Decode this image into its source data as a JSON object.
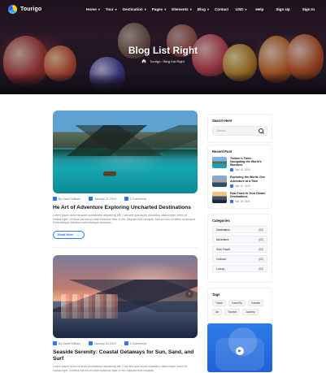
{
  "brand": {
    "name": "Tourigo",
    "colors": {
      "accent": "#2b74ff",
      "muted_text": "#7a7a7a",
      "hero_overlay": "#2f1a2c"
    }
  },
  "nav": {
    "items": [
      {
        "label": "Home"
      },
      {
        "label": "Tour"
      },
      {
        "label": "Destination"
      },
      {
        "label": "Pages"
      },
      {
        "label": "Elements"
      },
      {
        "label": "Blog"
      },
      {
        "label": "Contact"
      }
    ],
    "right": {
      "currency": "USD",
      "help": "Help",
      "signup": "Sign Up",
      "signin": "Sign In"
    }
  },
  "hero": {
    "title": "Blog List Right",
    "breadcrumb": {
      "home": "Tourigo",
      "current": "Blog List Right"
    }
  },
  "posts": [
    {
      "author": "By David William",
      "date": "January 22 2024",
      "comments": "0 Comments",
      "title": "He Art of Adventure Exploring Uncharted Destinations",
      "excerpt": "Lorem ipsum dolor sit amet consectetur adipiscing elit. Cras sed quis turpis phasellus ullamcorper lorem et massa eget. Ut tellus est nisl at vitae euismod vitae ut est. Aliquam erat volutpat. Sed ac nunc in tellus consequat. Pellentesque habitant morbi tristique senectus.",
      "button": "Read More"
    },
    {
      "author": "By David William",
      "date": "January 22 2024",
      "comments": "0 Comments",
      "title": "Seaside Serenity: Coastal Getaways for Sun, Sand, and Surf",
      "excerpt": "Lorem ipsum dolor sit amet consectetur adipiscing elit. Cras sed quis turpis phasellus ullamcorper lorem et massa eget. Ut tellus est nisl at vitae euismod vitae ut est. Aliquam erat volutpat."
    }
  ],
  "sidebar": {
    "search": {
      "title": "Search Here",
      "placeholder": "Search"
    },
    "recent": {
      "title": "Recent Post",
      "items": [
        {
          "title": "Trekker's Tales: Navigating the World's Wonders",
          "date": "Mar 18, 2024"
        },
        {
          "title": "Exploring the World: One Adventure at a Time",
          "date": "Mar 18, 2024"
        },
        {
          "title": "Fast-Track to Your Dream Destinations",
          "date": "Mar 18, 2024"
        }
      ]
    },
    "categories": {
      "title": "Categories",
      "items": [
        {
          "name": "Destination",
          "count": "(02)"
        },
        {
          "name": "Adventure",
          "count": "(02)"
        },
        {
          "name": "Solo Travel",
          "count": "(02)"
        },
        {
          "name": "Cultural",
          "count": "(02)"
        },
        {
          "name": "Luxury",
          "count": "(02)"
        }
      ]
    },
    "tags": {
      "title": "Tags",
      "items": [
        "Travel",
        "TravelTip",
        "Traveler",
        "Art",
        "Tourism",
        "Journey"
      ]
    }
  },
  "icons": {
    "search": "search-icon",
    "home": "home-icon",
    "calendar": "calendar-icon",
    "user": "user-icon",
    "comment": "comment-icon",
    "chevron_down": "chevron-down-icon",
    "chevron_right": "chevron-right-icon",
    "play": "play-icon",
    "arrow": "arrow-right-icon"
  }
}
